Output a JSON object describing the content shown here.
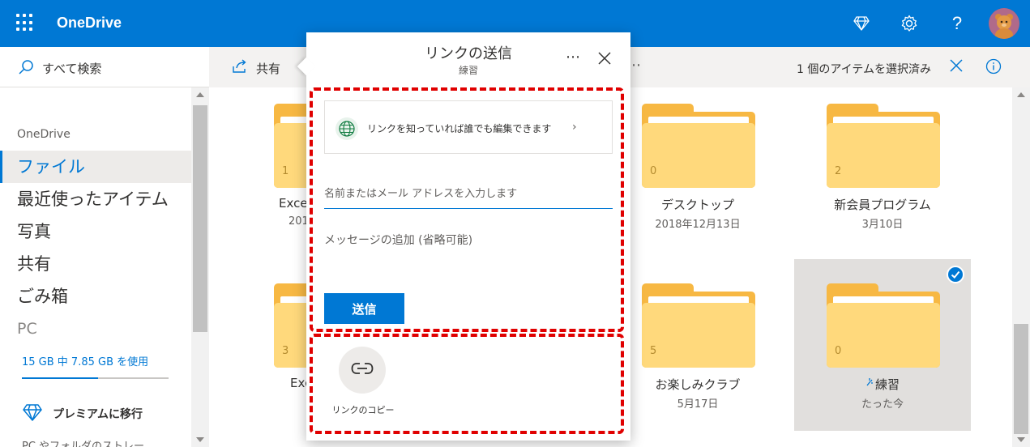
{
  "app": {
    "title": "OneDrive",
    "brand_color": "#0078d4"
  },
  "topbar": {
    "icons": [
      "waffle-icon",
      "diamond-icon",
      "gear-icon",
      "help-icon",
      "avatar"
    ],
    "help_glyph": "?"
  },
  "search": {
    "label": "すべて検索"
  },
  "commandbar": {
    "share_label": "共有",
    "more_glyph": "⋯",
    "selection_text": "1 個のアイテムを選択済み"
  },
  "nav": {
    "header": "OneDrive",
    "items": [
      {
        "label": "ファイル",
        "active": true
      },
      {
        "label": "最近使ったアイテム"
      },
      {
        "label": "写真"
      },
      {
        "label": "共有"
      },
      {
        "label": "ごみ箱"
      },
      {
        "label": "PC"
      }
    ],
    "storage_text": "15 GB 中 7.85 GB を使用",
    "storage_used_fraction": 0.52,
    "premium_label": "プレミアムに移行",
    "footer_text": "PC やフォルダのストレー"
  },
  "folders": [
    {
      "name": "Exce",
      "date": "201",
      "count": "1",
      "selected": false
    },
    {
      "name": "",
      "date": "",
      "count": "",
      "selected": false
    },
    {
      "name": "デスクトップ",
      "date": "2018年12月13日",
      "count": "0",
      "selected": false
    },
    {
      "name": "新会員プログラム",
      "date": "3月10日",
      "count": "2",
      "selected": false
    },
    {
      "name": "Exc",
      "date": "",
      "count": "3",
      "selected": false
    },
    {
      "name": "",
      "date": "",
      "count": "",
      "selected": false
    },
    {
      "name": "お楽しみクラブ",
      "date": "5月17日",
      "count": "5",
      "selected": false
    },
    {
      "name": "練習",
      "date": "たった今",
      "count": "0",
      "selected": true
    }
  ],
  "dialog": {
    "title": "リンクの送信",
    "subtitle": "練習",
    "more_glyph": "⋯",
    "link_setting": "リンクを知っていれば誰でも編集できます",
    "chevron_glyph": "›",
    "name_placeholder": "名前またはメール アドレスを入力します",
    "message_placeholder": "メッセージの追加 (省略可能)",
    "send_label": "送信",
    "copy_link_label": "リンクのコピー",
    "highlight_color": "#e00000"
  }
}
